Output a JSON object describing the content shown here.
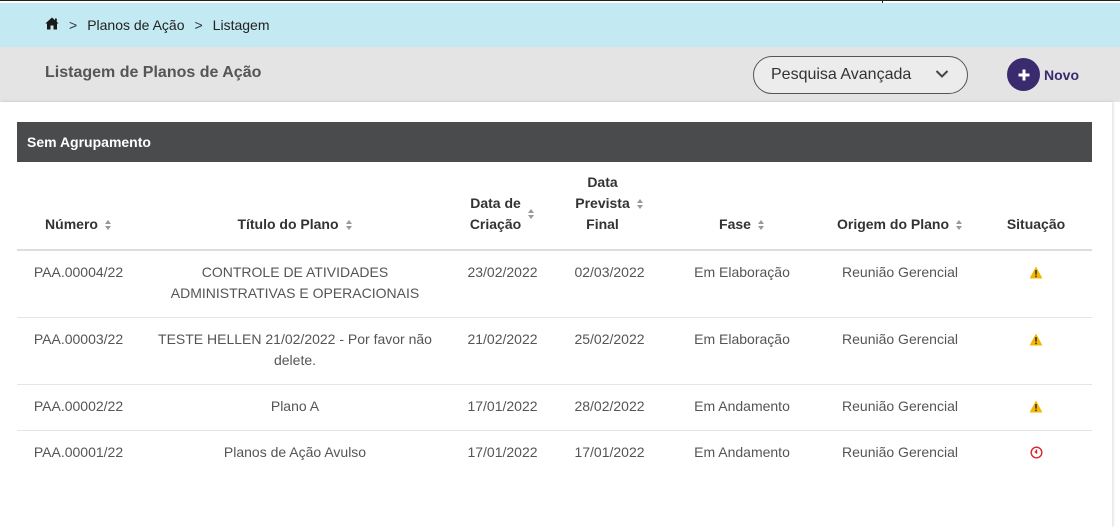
{
  "breadcrumb": {
    "home_icon": "home-icon",
    "items": [
      "Planos de Ação",
      "Listagem"
    ],
    "separator": ">"
  },
  "header": {
    "title": "Listagem de Planos de Ação",
    "advanced_search_label": "Pesquisa Avançada",
    "new_button_label": "Novo"
  },
  "group": {
    "label": "Sem Agrupamento"
  },
  "table": {
    "columns": [
      {
        "label": "Número",
        "sortable": true
      },
      {
        "label": "Título do Plano",
        "sortable": true
      },
      {
        "label": "Data de Criação",
        "label_lines": [
          "Data de",
          "Criação"
        ],
        "sortable": true
      },
      {
        "label": "Data Prevista Final",
        "label_lines": [
          "Data",
          "Prevista",
          "Final"
        ],
        "sortable": true
      },
      {
        "label": "Fase",
        "sortable": true
      },
      {
        "label": "Origem do Plano",
        "sortable": true
      },
      {
        "label": "Situação",
        "sortable": false
      }
    ],
    "rows": [
      {
        "numero": "PAA.00004/22",
        "titulo": "CONTROLE DE ATIVIDADES ADMINISTRATIVAS E OPERACIONAIS",
        "criacao": "23/02/2022",
        "prevista": "02/03/2022",
        "fase": "Em Elaboração",
        "origem": "Reunião Gerencial",
        "situacao_icon": "warning-icon"
      },
      {
        "numero": "PAA.00003/22",
        "titulo": "TESTE HELLEN 21/02/2022 - Por favor não delete.",
        "criacao": "21/02/2022",
        "prevista": "25/02/2022",
        "fase": "Em Elaboração",
        "origem": "Reunião Gerencial",
        "situacao_icon": "warning-icon"
      },
      {
        "numero": "PAA.00002/22",
        "titulo": "Plano A",
        "criacao": "17/01/2022",
        "prevista": "28/02/2022",
        "fase": "Em Andamento",
        "origem": "Reunião Gerencial",
        "situacao_icon": "warning-icon"
      },
      {
        "numero": "PAA.00001/22",
        "titulo": "Planos de Ação Avulso",
        "criacao": "17/01/2022",
        "prevista": "17/01/2022",
        "fase": "Em Andamento",
        "origem": "Reunião Gerencial",
        "situacao_icon": "clock-overdue-icon"
      }
    ]
  },
  "colors": {
    "breadcrumb_bg": "#c3e9f2",
    "header_bg": "#e4e4e4",
    "group_bar_bg": "#4a4b4d",
    "accent_purple": "#3a2a6e",
    "warning": "#f5b800",
    "overdue": "#d9262b"
  }
}
